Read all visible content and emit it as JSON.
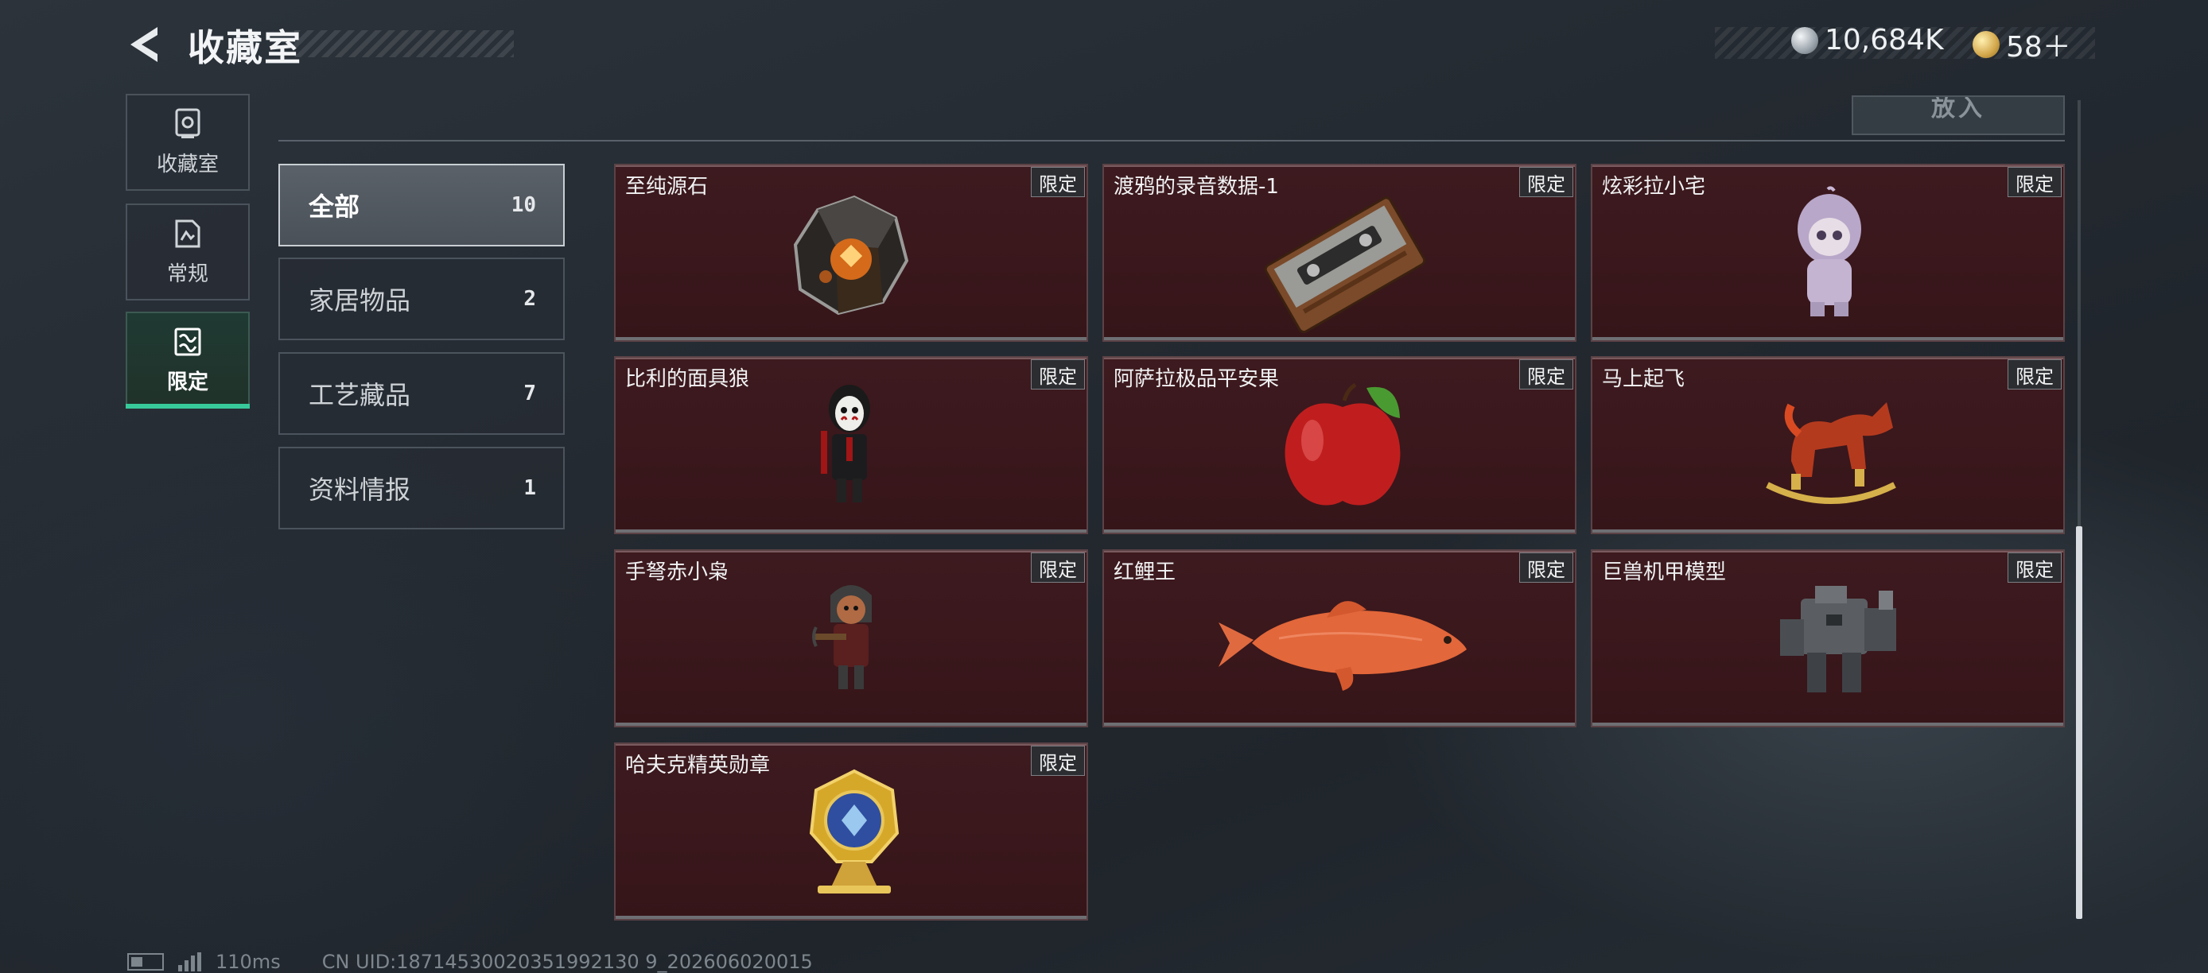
{
  "header": {
    "title": "收藏室",
    "currencies": [
      {
        "icon": "silver-coin-icon",
        "value": "10,684K"
      },
      {
        "icon": "gold-token-icon",
        "value": "58＋"
      }
    ]
  },
  "side_tabs": [
    {
      "label": "收藏室",
      "icon": "collection-icon",
      "active": false
    },
    {
      "label": "常规",
      "icon": "regular-items-icon",
      "active": false
    },
    {
      "label": "限定",
      "icon": "limited-items-icon",
      "active": true
    }
  ],
  "top_bar": {
    "partial_label": "",
    "partial_button": "放入"
  },
  "categories": [
    {
      "label": "全部",
      "count": "10",
      "active": true
    },
    {
      "label": "家居物品",
      "count": "2",
      "active": false
    },
    {
      "label": "工艺藏品",
      "count": "7",
      "active": false
    },
    {
      "label": "资料情报",
      "count": "1",
      "active": false
    }
  ],
  "items": [
    {
      "name": "至纯源石",
      "badge": "限定",
      "icon": "crystal-stone-icon"
    },
    {
      "name": "渡鸦的录音数据-1",
      "badge": "限定",
      "icon": "cassette-tape-icon"
    },
    {
      "name": "炫彩拉小宅",
      "badge": "限定",
      "icon": "hooded-figure-icon"
    },
    {
      "name": "比利的面具狼",
      "badge": "限定",
      "icon": "puppet-mask-icon"
    },
    {
      "name": "阿萨拉极品平安果",
      "badge": "限定",
      "icon": "red-apple-icon"
    },
    {
      "name": "马上起飞",
      "badge": "限定",
      "icon": "rocking-horse-icon"
    },
    {
      "name": "手弩赤小枭",
      "badge": "限定",
      "icon": "crossbow-figure-icon"
    },
    {
      "name": "红鲤王",
      "badge": "限定",
      "icon": "red-carp-icon"
    },
    {
      "name": "巨兽机甲模型",
      "badge": "限定",
      "icon": "mech-model-icon"
    },
    {
      "name": "哈夫克精英勋章",
      "badge": "限定",
      "icon": "medal-icon"
    }
  ],
  "footer": {
    "ping": "110ms",
    "uid": "CN UID:18714530020351992130 9_202606020015"
  }
}
